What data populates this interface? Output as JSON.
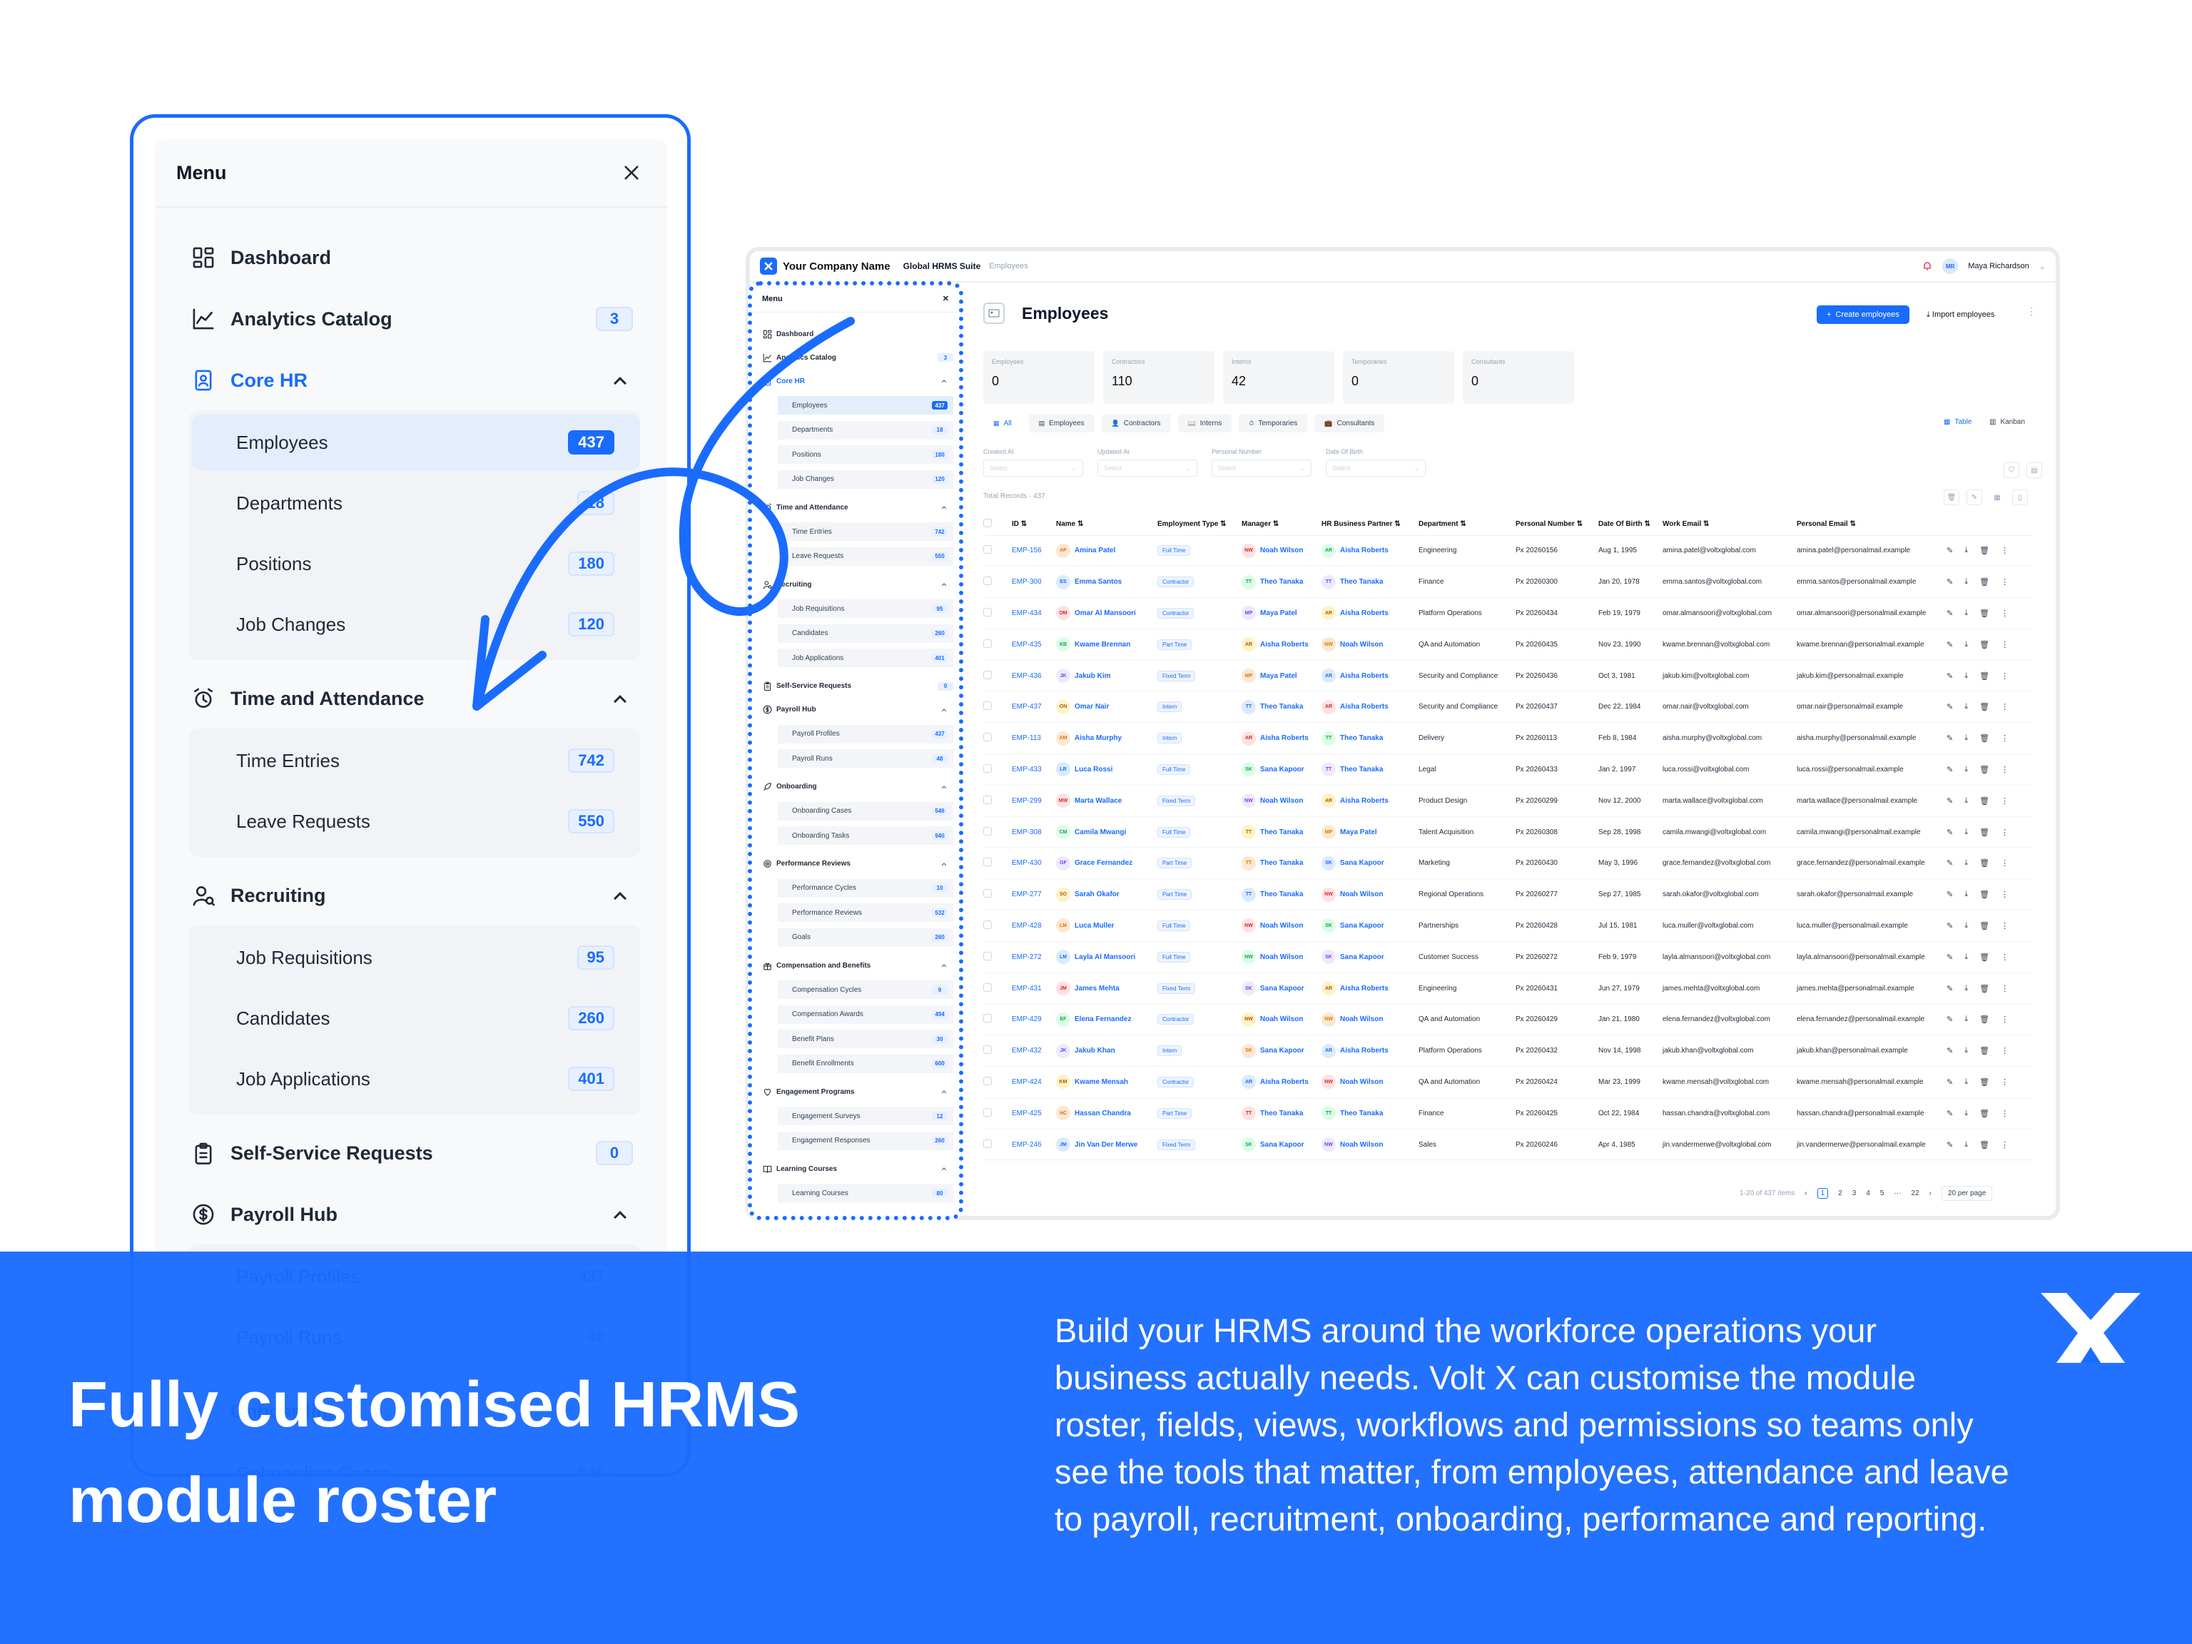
{
  "colors": {
    "brand": "#1a6bff",
    "banner": "#1a6bff",
    "text": "#0f172a"
  },
  "big_menu": {
    "title": "Menu",
    "items": [
      {
        "label": "Dashboard",
        "icon": "dashboard-icon"
      },
      {
        "label": "Analytics Catalog",
        "icon": "chart-icon",
        "count": "3"
      },
      {
        "label": "Core HR",
        "icon": "core-hr-icon",
        "expanded": true,
        "children": [
          {
            "label": "Employees",
            "count": "437",
            "active": true
          },
          {
            "label": "Departments",
            "count": "18"
          },
          {
            "label": "Positions",
            "count": "180"
          },
          {
            "label": "Job Changes",
            "count": "120"
          }
        ]
      },
      {
        "label": "Time and Attendance",
        "icon": "alarm-clock-icon",
        "expanded": true,
        "children": [
          {
            "label": "Time Entries",
            "count": "742"
          },
          {
            "label": "Leave Requests",
            "count": "550"
          }
        ]
      },
      {
        "label": "Recruiting",
        "icon": "user-search-icon",
        "expanded": true,
        "children": [
          {
            "label": "Job Requisitions",
            "count": "95"
          },
          {
            "label": "Candidates",
            "count": "260"
          },
          {
            "label": "Job Applications",
            "count": "401"
          }
        ]
      },
      {
        "label": "Self-Service Requests",
        "icon": "clipboard-icon",
        "count": "0"
      },
      {
        "label": "Payroll Hub",
        "icon": "dollar-icon",
        "expanded": true,
        "children": [
          {
            "label": "Payroll Profiles",
            "count": "437"
          },
          {
            "label": "Payroll Runs",
            "count": "48"
          }
        ]
      },
      {
        "label": "Onboarding",
        "icon": "rocket-icon",
        "expanded": true,
        "children": [
          {
            "label": "Onboarding Cases",
            "count": "546"
          }
        ]
      }
    ]
  },
  "topbar": {
    "company": "Your Company Name",
    "suite": "Global HRMS Suite",
    "crumb": "Employees",
    "user": "Maya Richardson",
    "user_initials": "MR"
  },
  "small_menu": {
    "title": "Menu",
    "sections": [
      {
        "label": "Dashboard",
        "icon": "dashboard-icon"
      },
      {
        "label": "Analytics Catalog",
        "icon": "chart-icon",
        "count": "3"
      },
      {
        "label": "Core HR",
        "icon": "core-hr-icon",
        "blue": true,
        "children": [
          {
            "label": "Employees",
            "count": "437",
            "active": true
          },
          {
            "label": "Departments",
            "count": "18"
          },
          {
            "label": "Positions",
            "count": "180"
          },
          {
            "label": "Job Changes",
            "count": "120"
          }
        ]
      },
      {
        "label": "Time and Attendance",
        "icon": "alarm-clock-icon",
        "children": [
          {
            "label": "Time Entries",
            "count": "742"
          },
          {
            "label": "Leave Requests",
            "count": "550"
          }
        ]
      },
      {
        "label": "Recruiting",
        "icon": "user-search-icon",
        "children": [
          {
            "label": "Job Requisitions",
            "count": "95"
          },
          {
            "label": "Candidates",
            "count": "260"
          },
          {
            "label": "Job Applications",
            "count": "401"
          }
        ]
      },
      {
        "label": "Self-Service Requests",
        "icon": "clipboard-icon",
        "count": "0"
      },
      {
        "label": "Payroll Hub",
        "icon": "dollar-icon",
        "children": [
          {
            "label": "Payroll Profiles",
            "count": "437"
          },
          {
            "label": "Payroll Runs",
            "count": "48"
          }
        ]
      },
      {
        "label": "Onboarding",
        "icon": "rocket-icon",
        "children": [
          {
            "label": "Onboarding Cases",
            "count": "546"
          },
          {
            "label": "Onboarding Tasks",
            "count": "940"
          }
        ]
      },
      {
        "label": "Performance Reviews",
        "icon": "target-icon",
        "children": [
          {
            "label": "Performance Cycles",
            "count": "10"
          },
          {
            "label": "Performance Reviews",
            "count": "532"
          },
          {
            "label": "Goals",
            "count": "260"
          }
        ]
      },
      {
        "label": "Compensation and Benefits",
        "icon": "gift-icon",
        "children": [
          {
            "label": "Compensation Cycles",
            "count": "9"
          },
          {
            "label": "Compensation Awards",
            "count": "494"
          },
          {
            "label": "Benefit Plans",
            "count": "30"
          },
          {
            "label": "Benefit Enrollments",
            "count": "600"
          }
        ]
      },
      {
        "label": "Engagement Programs",
        "icon": "heart-icon",
        "children": [
          {
            "label": "Engagement Surveys",
            "count": "12"
          },
          {
            "label": "Engagement Responses",
            "count": "260"
          }
        ]
      },
      {
        "label": "Learning Courses",
        "icon": "book-icon",
        "children": [
          {
            "label": "Learning Courses",
            "count": "80"
          }
        ]
      }
    ]
  },
  "page": {
    "title": "Employees",
    "create_label": "Create employees",
    "import_label": "Import employees",
    "stats": [
      {
        "label": "Employees",
        "value": "0"
      },
      {
        "label": "Contractors",
        "value": "110"
      },
      {
        "label": "Interns",
        "value": "42"
      },
      {
        "label": "Temporaries",
        "value": "0"
      },
      {
        "label": "Consultants",
        "value": "0"
      }
    ],
    "tabs": [
      "All",
      "Employees",
      "Contractors",
      "Interns",
      "Temporaries",
      "Consultants"
    ],
    "views": [
      "Table",
      "Kanban"
    ],
    "filters": [
      {
        "label": "Created At",
        "placeholder": "Select"
      },
      {
        "label": "Updated At",
        "placeholder": "Select"
      },
      {
        "label": "Personal Number",
        "placeholder": "Select"
      },
      {
        "label": "Date Of Birth",
        "placeholder": "Select"
      }
    ],
    "total": "Total Records · 437",
    "columns": [
      "ID",
      "Name",
      "Employment Type",
      "Manager",
      "HR Business Partner",
      "Department",
      "Personal Number",
      "Date Of Birth",
      "Work Email",
      "Personal Email"
    ],
    "rows": [
      [
        "EMP-156",
        "Amina Patel",
        "AP",
        "Full Time",
        "Noah Wilson",
        "NW",
        "Aisha Roberts",
        "AR",
        "Engineering",
        "Px 20260156",
        "Aug 1, 1995",
        "amina.patel@voltxglobal.com",
        "amina.patel@personalmail.example"
      ],
      [
        "EMP-300",
        "Emma Santos",
        "ES",
        "Contractor",
        "Theo Tanaka",
        "TT",
        "Theo Tanaka",
        "TT",
        "Finance",
        "Px 20260300",
        "Jan 20, 1978",
        "emma.santos@voltxglobal.com",
        "emma.santos@personalmail.example"
      ],
      [
        "EMP-434",
        "Omar Al Mansoori",
        "OM",
        "Contractor",
        "Maya Patel",
        "MP",
        "Aisha Roberts",
        "AR",
        "Platform Operations",
        "Px 20260434",
        "Feb 19, 1979",
        "omar.almansoori@voltxglobal.com",
        "omar.almansoori@personalmail.example"
      ],
      [
        "EMP-435",
        "Kwame Brennan",
        "KB",
        "Part Time",
        "Aisha Roberts",
        "AR",
        "Noah Wilson",
        "NW",
        "QA and Automation",
        "Px 20260435",
        "Nov 23, 1990",
        "kwame.brennan@voltxglobal.com",
        "kwame.brennan@personalmail.example"
      ],
      [
        "EMP-436",
        "Jakub Kim",
        "JK",
        "Fixed Term",
        "Maya Patel",
        "MP",
        "Aisha Roberts",
        "AR",
        "Security and Compliance",
        "Px 20260436",
        "Oct 3, 1981",
        "jakub.kim@voltxglobal.com",
        "jakub.kim@personalmail.example"
      ],
      [
        "EMP-437",
        "Omar Nair",
        "ON",
        "Intern",
        "Theo Tanaka",
        "TT",
        "Aisha Roberts",
        "AR",
        "Security and Compliance",
        "Px 20260437",
        "Dec 22, 1984",
        "omar.nair@voltxglobal.com",
        "omar.nair@personalmail.example"
      ],
      [
        "EMP-113",
        "Aisha Murphy",
        "AM",
        "Intern",
        "Aisha Roberts",
        "AR",
        "Theo Tanaka",
        "TT",
        "Delivery",
        "Px 20260113",
        "Feb 8, 1984",
        "aisha.murphy@voltxglobal.com",
        "aisha.murphy@personalmail.example"
      ],
      [
        "EMP-433",
        "Luca Rossi",
        "LR",
        "Full Time",
        "Sana Kapoor",
        "SK",
        "Theo Tanaka",
        "TT",
        "Legal",
        "Px 20260433",
        "Jan 2, 1997",
        "luca.rossi@voltxglobal.com",
        "luca.rossi@personalmail.example"
      ],
      [
        "EMP-299",
        "Marta Wallace",
        "MW",
        "Fixed Term",
        "Noah Wilson",
        "NW",
        "Aisha Roberts",
        "AR",
        "Product Design",
        "Px 20260299",
        "Nov 12, 2000",
        "marta.wallace@voltxglobal.com",
        "marta.wallace@personalmail.example"
      ],
      [
        "EMP-308",
        "Camila Mwangi",
        "CM",
        "Full Time",
        "Theo Tanaka",
        "TT",
        "Maya Patel",
        "MP",
        "Talent Acquisition",
        "Px 20260308",
        "Sep 28, 1998",
        "camila.mwangi@voltxglobal.com",
        "camila.mwangi@personalmail.example"
      ],
      [
        "EMP-430",
        "Grace Fernandez",
        "GF",
        "Part Time",
        "Theo Tanaka",
        "TT",
        "Sana Kapoor",
        "SK",
        "Marketing",
        "Px 20260430",
        "May 3, 1996",
        "grace.fernandez@voltxglobal.com",
        "grace.fernandez@personalmail.example"
      ],
      [
        "EMP-277",
        "Sarah Okafor",
        "SO",
        "Part Time",
        "Theo Tanaka",
        "TT",
        "Noah Wilson",
        "NW",
        "Regional Operations",
        "Px 20260277",
        "Sep 27, 1985",
        "sarah.okafor@voltxglobal.com",
        "sarah.okafor@personalmail.example"
      ],
      [
        "EMP-428",
        "Luca Muller",
        "LM",
        "Full Time",
        "Noah Wilson",
        "NW",
        "Sana Kapoor",
        "SK",
        "Partnerships",
        "Px 20260428",
        "Jul 15, 1981",
        "luca.muller@voltxglobal.com",
        "luca.muller@personalmail.example"
      ],
      [
        "EMP-272",
        "Layla Al Mansoori",
        "LM",
        "Full Time",
        "Noah Wilson",
        "NW",
        "Sana Kapoor",
        "SK",
        "Customer Success",
        "Px 20260272",
        "Feb 9, 1979",
        "layla.almansoori@voltxglobal.com",
        "layla.almansoori@personalmail.example"
      ],
      [
        "EMP-431",
        "James Mehta",
        "JM",
        "Fixed Term",
        "Sana Kapoor",
        "SK",
        "Aisha Roberts",
        "AR",
        "Engineering",
        "Px 20260431",
        "Jun 27, 1979",
        "james.mehta@voltxglobal.com",
        "james.mehta@personalmail.example"
      ],
      [
        "EMP-429",
        "Elena Fernandez",
        "EF",
        "Contractor",
        "Noah Wilson",
        "NW",
        "Noah Wilson",
        "NW",
        "QA and Automation",
        "Px 20260429",
        "Jan 21, 1980",
        "elena.fernandez@voltxglobal.com",
        "elena.fernandez@personalmail.example"
      ],
      [
        "EMP-432",
        "Jakub Khan",
        "JK",
        "Intern",
        "Sana Kapoor",
        "SK",
        "Aisha Roberts",
        "AR",
        "Platform Operations",
        "Px 20260432",
        "Nov 14, 1998",
        "jakub.khan@voltxglobal.com",
        "jakub.khan@personalmail.example"
      ],
      [
        "EMP-424",
        "Kwame Mensah",
        "KM",
        "Contractor",
        "Aisha Roberts",
        "AR",
        "Noah Wilson",
        "NW",
        "QA and Automation",
        "Px 20260424",
        "Mar 23, 1999",
        "kwame.mensah@voltxglobal.com",
        "kwame.mensah@personalmail.example"
      ],
      [
        "EMP-425",
        "Hassan Chandra",
        "HC",
        "Part Time",
        "Theo Tanaka",
        "TT",
        "Theo Tanaka",
        "TT",
        "Finance",
        "Px 20260425",
        "Oct 22, 1984",
        "hassan.chandra@voltxglobal.com",
        "hassan.chandra@personalmail.example"
      ],
      [
        "EMP-246",
        "Jin Van Der Merwe",
        "JM",
        "Fixed Term",
        "Sana Kapoor",
        "SK",
        "Noah Wilson",
        "NW",
        "Sales",
        "Px 20260246",
        "Apr 4, 1985",
        "jin.vandermerwe@voltxglobal.com",
        "jin.vandermerwe@personalmail.example"
      ]
    ],
    "pagination": {
      "range": "1-20 of 437 items",
      "pages": [
        "1",
        "2",
        "3",
        "4",
        "5",
        "···",
        "22"
      ],
      "per_page": "20 per page"
    }
  },
  "banner": {
    "headline_1": "Fully customised HRMS",
    "headline_2": "module roster",
    "description": "Build your HRMS around the workforce operations your business actually needs. Volt X can customise the module roster, fields, views, workflows and permissions so teams only see the tools that matter, from employees, attendance and leave to payroll, recruitment, onboarding, performance and reporting."
  }
}
